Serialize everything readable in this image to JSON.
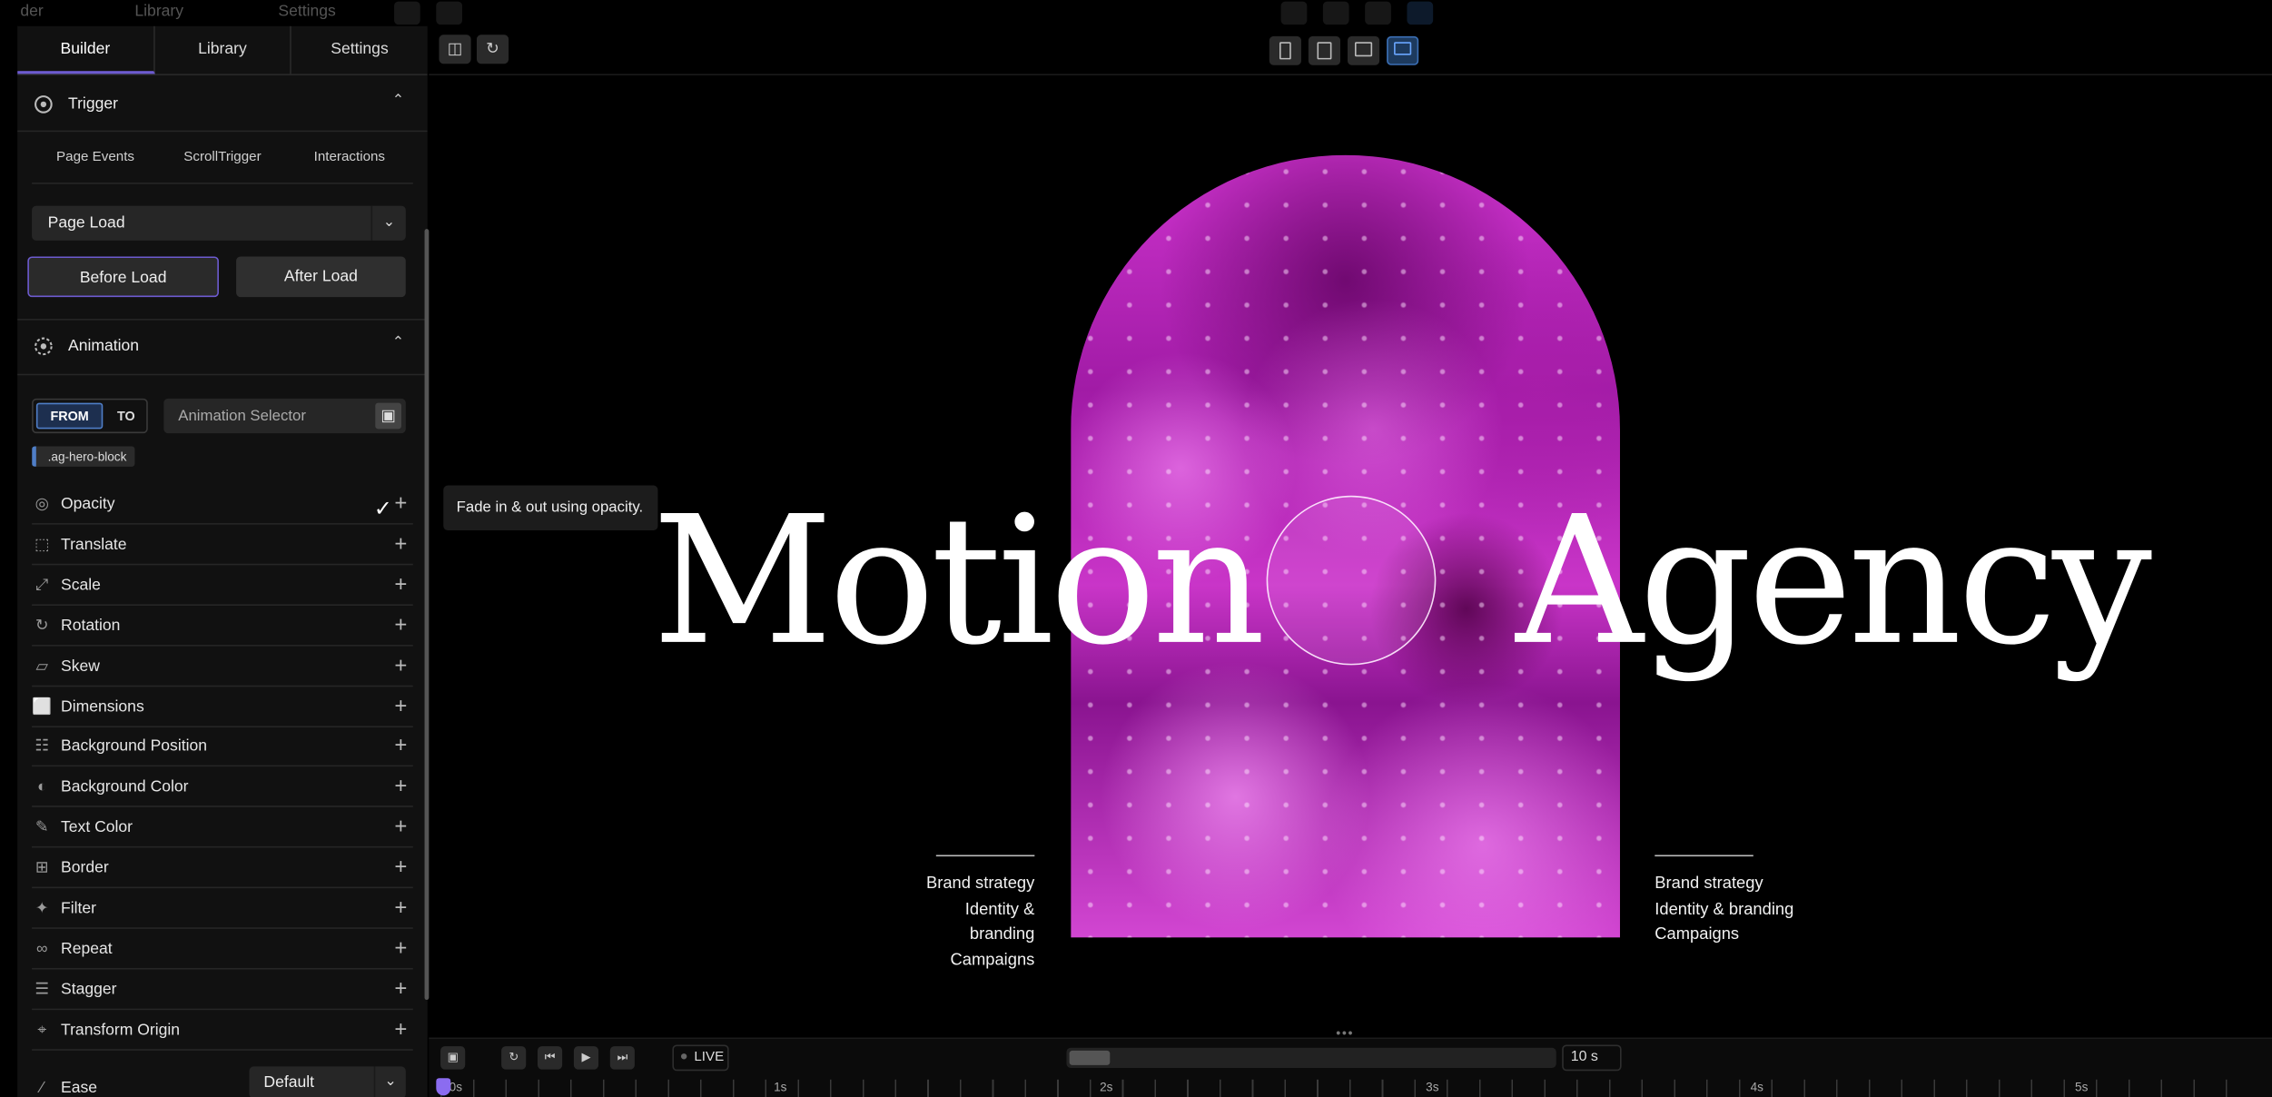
{
  "ghost_header": {
    "left": "der",
    "library": "Library",
    "settings": "Settings"
  },
  "tabs": [
    {
      "label": "Builder"
    },
    {
      "label": "Library"
    },
    {
      "label": "Settings"
    }
  ],
  "trigger": {
    "title": "Trigger",
    "subtabs": [
      "Page Events",
      "ScrollTrigger",
      "Interactions"
    ],
    "event_select": "Page Load",
    "before_load": "Before Load",
    "after_load": "After Load"
  },
  "animation": {
    "title": "Animation",
    "from": "FROM",
    "to": "TO",
    "selector_placeholder": "Animation Selector",
    "selected_tag": ".ag-hero-block"
  },
  "properties": [
    {
      "label": "Opacity",
      "icon": "opacity-icon"
    },
    {
      "label": "Translate",
      "icon": "translate-icon"
    },
    {
      "label": "Scale",
      "icon": "scale-icon"
    },
    {
      "label": "Rotation",
      "icon": "rotation-icon"
    },
    {
      "label": "Skew",
      "icon": "skew-icon"
    },
    {
      "label": "Dimensions",
      "icon": "dimensions-icon"
    },
    {
      "label": "Background Position",
      "icon": "background-position-icon"
    },
    {
      "label": "Background Color",
      "icon": "background-color-icon"
    },
    {
      "label": "Text Color",
      "icon": "text-color-icon"
    },
    {
      "label": "Border",
      "icon": "border-icon"
    },
    {
      "label": "Filter",
      "icon": "filter-icon"
    },
    {
      "label": "Repeat",
      "icon": "repeat-icon"
    },
    {
      "label": "Stagger",
      "icon": "stagger-icon"
    },
    {
      "label": "Transform Origin",
      "icon": "transform-origin-icon"
    }
  ],
  "ease": {
    "label": "Ease",
    "value": "Default"
  },
  "tooltip": "Fade in & out using opacity.",
  "hero": {
    "word1": "Motion",
    "word2": "Agency"
  },
  "services_left": [
    "Brand strategy",
    "Identity & branding",
    "Campaigns"
  ],
  "services_right": [
    "Brand strategy",
    "Identity & branding",
    "Campaigns"
  ],
  "timeline": {
    "live": "LIVE",
    "duration": "10 s",
    "start": "0s",
    "ticks": [
      "1s",
      "2s",
      "3s",
      "4s",
      "5s"
    ]
  },
  "colors": {
    "accent": "#6d5bd0",
    "selection_blue": "#4f7ec7",
    "artwork_magenta": "#c935c8"
  }
}
